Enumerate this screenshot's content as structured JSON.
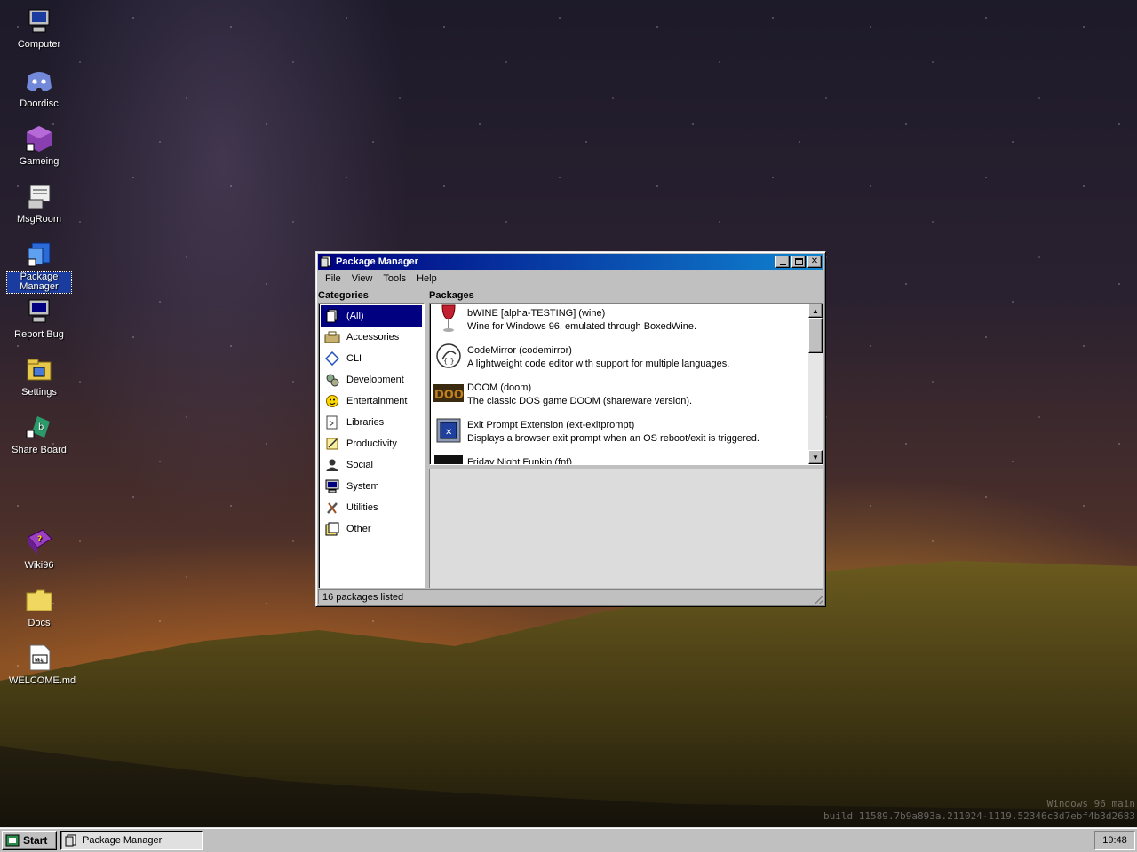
{
  "desktop": {
    "icons": [
      {
        "label": "Computer",
        "icon": "computer-icon"
      },
      {
        "label": "Doordisc",
        "icon": "discord-icon"
      },
      {
        "label": "Gameing",
        "icon": "game-cube-icon"
      },
      {
        "label": "MsgRoom",
        "icon": "msgroom-icon"
      },
      {
        "label": "Package Manager",
        "icon": "package-manager-icon"
      },
      {
        "label": "Report Bug",
        "icon": "report-bug-icon"
      },
      {
        "label": "Settings",
        "icon": "settings-icon"
      },
      {
        "label": "Share Board",
        "icon": "share-board-icon"
      },
      {
        "label": "Wiki96",
        "icon": "wiki-book-icon"
      },
      {
        "label": "Docs",
        "icon": "folder-icon"
      },
      {
        "label": "WELCOME.md",
        "icon": "markdown-file-icon"
      }
    ],
    "watermark_line1": "Windows 96 main",
    "watermark_line2": "build 11589.7b9a893a.211024-1119.52346c3d7ebf4b3d2683"
  },
  "window": {
    "title": "Package Manager",
    "menu": [
      "File",
      "View",
      "Tools",
      "Help"
    ],
    "categories_label": "Categories",
    "packages_label": "Packages",
    "categories": [
      {
        "label": "(All)",
        "icon": "all-icon",
        "selected": true
      },
      {
        "label": "Accessories",
        "icon": "accessories-icon"
      },
      {
        "label": "CLI",
        "icon": "cli-icon"
      },
      {
        "label": "Development",
        "icon": "development-icon"
      },
      {
        "label": "Entertainment",
        "icon": "entertainment-icon"
      },
      {
        "label": "Libraries",
        "icon": "libraries-icon"
      },
      {
        "label": "Productivity",
        "icon": "productivity-icon"
      },
      {
        "label": "Social",
        "icon": "social-icon"
      },
      {
        "label": "System",
        "icon": "system-icon"
      },
      {
        "label": "Utilities",
        "icon": "utilities-icon"
      },
      {
        "label": "Other",
        "icon": "other-icon"
      }
    ],
    "packages": [
      {
        "name": "bWINE [alpha-TESTING] (wine)",
        "desc": "Wine for Windows 96, emulated through BoxedWine.",
        "icon": "wine-glass-icon"
      },
      {
        "name": "CodeMirror (codemirror)",
        "desc": "A lightweight code editor with support for multiple languages.",
        "icon": "codemirror-icon"
      },
      {
        "name": "DOOM (doom)",
        "desc": "The classic DOS game DOOM (shareware version).",
        "icon": "doom-icon"
      },
      {
        "name": "Exit Prompt Extension (ext-exitprompt)",
        "desc": "Displays a browser exit prompt when an OS reboot/exit is triggered.",
        "icon": "extension-icon"
      },
      {
        "name": "Friday Night Funkin (fnf)",
        "desc": "",
        "icon": "fnf-icon"
      }
    ],
    "status": "16 packages listed"
  },
  "taskbar": {
    "start_label": "Start",
    "task_label": "Package Manager",
    "clock": "19:48"
  }
}
